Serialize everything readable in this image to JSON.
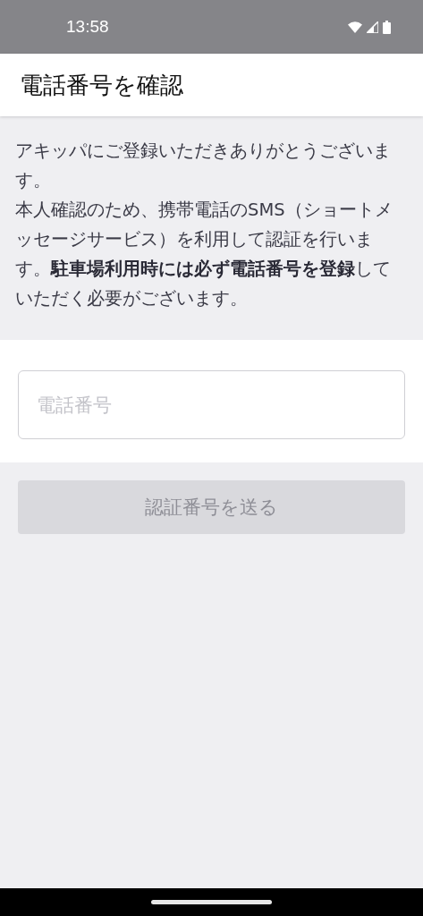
{
  "status_bar": {
    "time": "13:58"
  },
  "app_bar": {
    "title": "電話番号を確認"
  },
  "intro": {
    "paragraphs": [
      "アキッパにご登録いただきありがとうございます。",
      "本人確認のため、携帯電話のSMS（ショートメッセージサービス）を利用して認証を行います。**駐車場利用時には必ず電話番号を登録**していただく必要がございます。"
    ]
  },
  "phone_field": {
    "placeholder": "電話番号"
  },
  "send_button": {
    "label": "認証番号を送る",
    "disabled": true
  }
}
